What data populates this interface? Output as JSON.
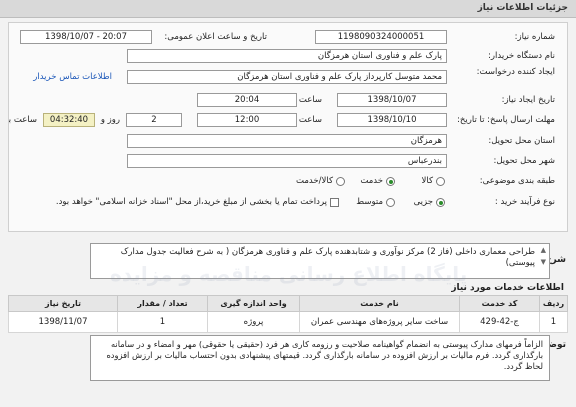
{
  "page": {
    "header_title": "جزئیات اطلاعات نیاز"
  },
  "form": {
    "need_number_label": "شماره نیاز:",
    "need_number": "1198090324000051",
    "announce_label": "تاریخ و ساعت اعلان عمومی:",
    "announce_value": "1398/10/07 - 20:07",
    "buyer_org_label": "نام دستگاه خریدار:",
    "buyer_org": "پارک علم و فناوری استان هرمزگان",
    "creator_label": "ایجاد کننده درخواست:",
    "creator": "محمد متوسل کارپرداز پارک علم و فناوری استان هرمزگان",
    "contact_link": "اطلاعات تماس خریدار",
    "created_date_label": "تاریخ ایجاد نیاز:",
    "created_date": "1398/10/07",
    "time_label": "ساعت",
    "created_time": "20:04",
    "deadline_label": "مهلت ارسال پاسخ: تا تاریخ:",
    "deadline_date": "1398/10/10",
    "deadline_time": "12:00",
    "days_value": "2",
    "days_label": "روز و",
    "remaining_time": "04:32:40",
    "remaining_label": "ساعت باقی مانده",
    "province_label": "استان محل تحویل:",
    "province": "هرمزگان",
    "city_label": "شهر محل تحویل:",
    "city": "بندرعباس",
    "category_label": "طبقه بندی موضوعی:",
    "category_options": [
      "کالا",
      "خدمت",
      "کالا/خدمت"
    ],
    "category_selected": 1,
    "purchase_type_label": "نوع فرآیند خرید :",
    "purchase_options": [
      "جزیی",
      "متوسط"
    ],
    "purchase_selected": 0,
    "payment_note": "پرداخت تمام یا بخشی از مبلغ خرید،از محل \"اسناد خزانه اسلامی\" خواهد بود."
  },
  "description": {
    "label": "شرح کلی نیاز:",
    "text": "طراحی معماری داخلی (فاز 2) مرکز نوآوری و شتابدهنده پارک علم و فناوری هرمزگان ( به شرح فعالیت جدول مدارک پیوستی)"
  },
  "services": {
    "section_title": "اطلاعات خدمات مورد نیاز",
    "columns": [
      "ردیف",
      "کد خدمت",
      "نام خدمت",
      "واحد اندازه گیری",
      "تعداد / مقدار",
      "تاریخ نیاز"
    ],
    "rows": [
      [
        "1",
        "ج-42-429",
        "ساخت سایر پروژه‌های مهندسی عمران",
        "پروژه",
        "1",
        "1398/11/07"
      ]
    ]
  },
  "notes": {
    "label": "توضیحات خریدار:",
    "text": "الزاماً فرمهای مدارک پیوستی به انضمام گواهینامه صلاحیت و رزومه کاری هر فرد (حقیقی یا حقوقی) مهر و امضاء و در سامانه بارگذاری گردد. فرم مالیات بر ارزش افزوده در سامانه بارگذاری گردد. قیمتهای پیشنهادی بدون احتساب مالیات بر ارزش افزوده لحاظ گردد."
  },
  "watermark": "پایگاه اطلاع رسانی مناقصه و مزایده"
}
